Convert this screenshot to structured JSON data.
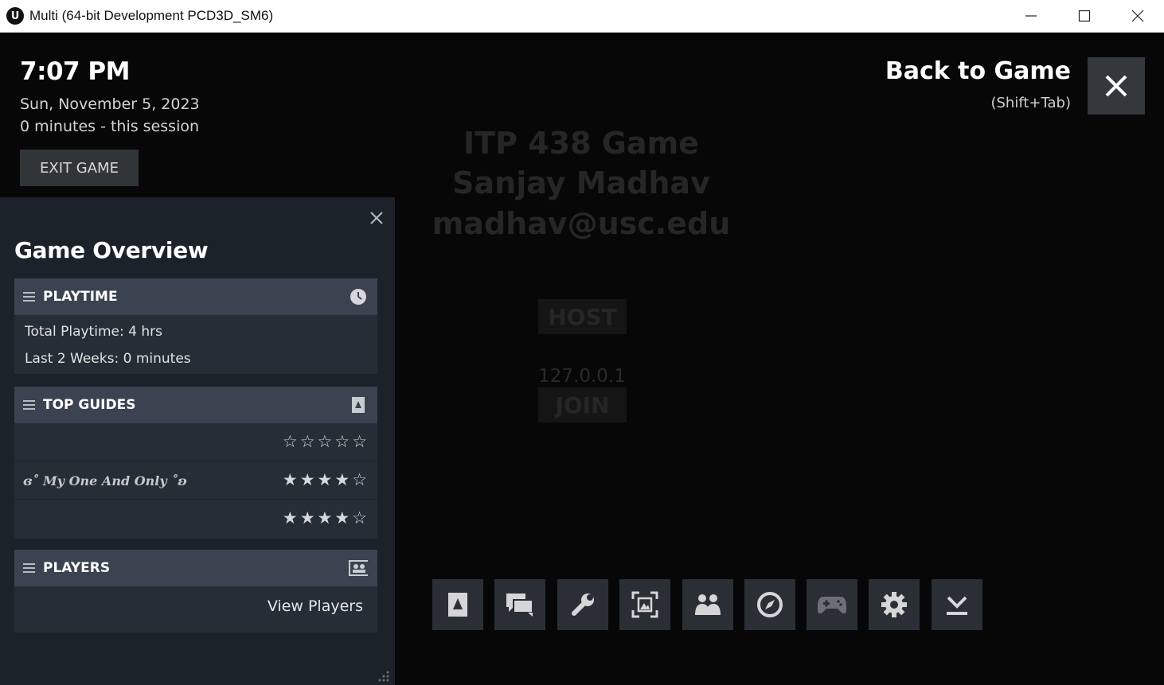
{
  "window": {
    "title": "Multi (64-bit Development PCD3D_SM6)",
    "app_icon_letter": "U"
  },
  "game_background": {
    "line1": "ITP 438 Game",
    "line2": "Sanjay Madhav",
    "line3": "madhav@usc.edu",
    "host_label": "HOST",
    "ip_value": "127.0.0.1",
    "join_label": "JOIN"
  },
  "overlay": {
    "time": "7:07 PM",
    "date": "Sun, November 5, 2023",
    "session": "0 minutes - this session",
    "exit_label": "EXIT GAME",
    "back_label": "Back to Game",
    "back_hint": "(Shift+Tab)"
  },
  "panel": {
    "title": "Game Overview",
    "playtime": {
      "header": "PLAYTIME",
      "total": "Total Playtime: 4 hrs",
      "last2weeks": "Last 2 Weeks: 0 minutes"
    },
    "guides": {
      "header": "TOP GUIDES",
      "items": [
        {
          "title": "",
          "rating": 0
        },
        {
          "title": "ɞ˚ My One And Only ˚ʚ",
          "rating": 4
        },
        {
          "title": "",
          "rating": 4
        }
      ]
    },
    "players": {
      "header": "PLAYERS",
      "view_label": "View Players"
    }
  },
  "toolbar": {
    "buttons": [
      "history-icon",
      "guide-book-icon",
      "chat-icon",
      "wrench-icon",
      "screenshot-icon",
      "friends-icon",
      "compass-icon",
      "controller-icon",
      "gear-icon",
      "download-icon"
    ]
  },
  "colors": {
    "panel_bg": "#1c222a",
    "section_header": "#3b4250",
    "section_body": "#262d37",
    "button_bg": "#2a2f35"
  }
}
